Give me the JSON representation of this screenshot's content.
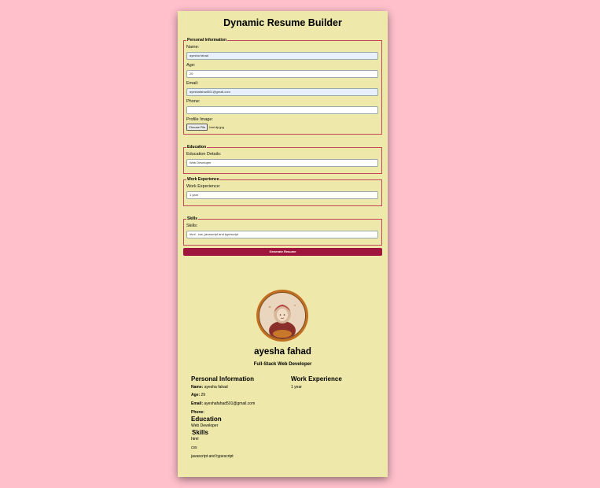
{
  "app": {
    "title": "Dynamic Resume Builder"
  },
  "form": {
    "personal": {
      "legend": "Personal Information",
      "name_label": "Name:",
      "name_value": "ayesha fahad",
      "age_label": "Age:",
      "age_value": "29",
      "email_label": "Email:",
      "email_value": "ayeshafahad501@gmail.com",
      "phone_label": "Phone:",
      "phone_value": "",
      "image_label": "Profile Image:",
      "file_button": "Choose File",
      "file_name": "bmi dp.jpg"
    },
    "education": {
      "legend": "Education",
      "label": "Education Details:",
      "value": "Web Developer"
    },
    "work": {
      "legend": "Work Experience",
      "label": "Work Experience:",
      "value": "1 year"
    },
    "skills": {
      "legend": "Skills",
      "label": "Skills:",
      "value": "html , css, javascript  and typescript"
    },
    "generate_label": "Generate Resume"
  },
  "resume": {
    "name": "ayesha fahad",
    "title": "Full-Stack Web Developer",
    "personal_heading": "Personal Information",
    "name_key": "Name:",
    "name_val": "ayesha fahad",
    "age_key": "Age:",
    "age_val": "29",
    "email_key": "Email:",
    "email_val": "ayeshafahad501@gmail.com",
    "phone_key": "Phone:",
    "education_heading": "Education",
    "education_val": "Web Developer",
    "skills_heading": "Skills",
    "skills": [
      "html",
      "css",
      "javascript and typescript"
    ],
    "work_heading": "Work Experience",
    "work_val": "1 year"
  },
  "colors": {
    "background": "#ffc0cb",
    "card": "#eee8aa",
    "accent": "#a0153e",
    "fieldset_border": "#c0485a"
  }
}
